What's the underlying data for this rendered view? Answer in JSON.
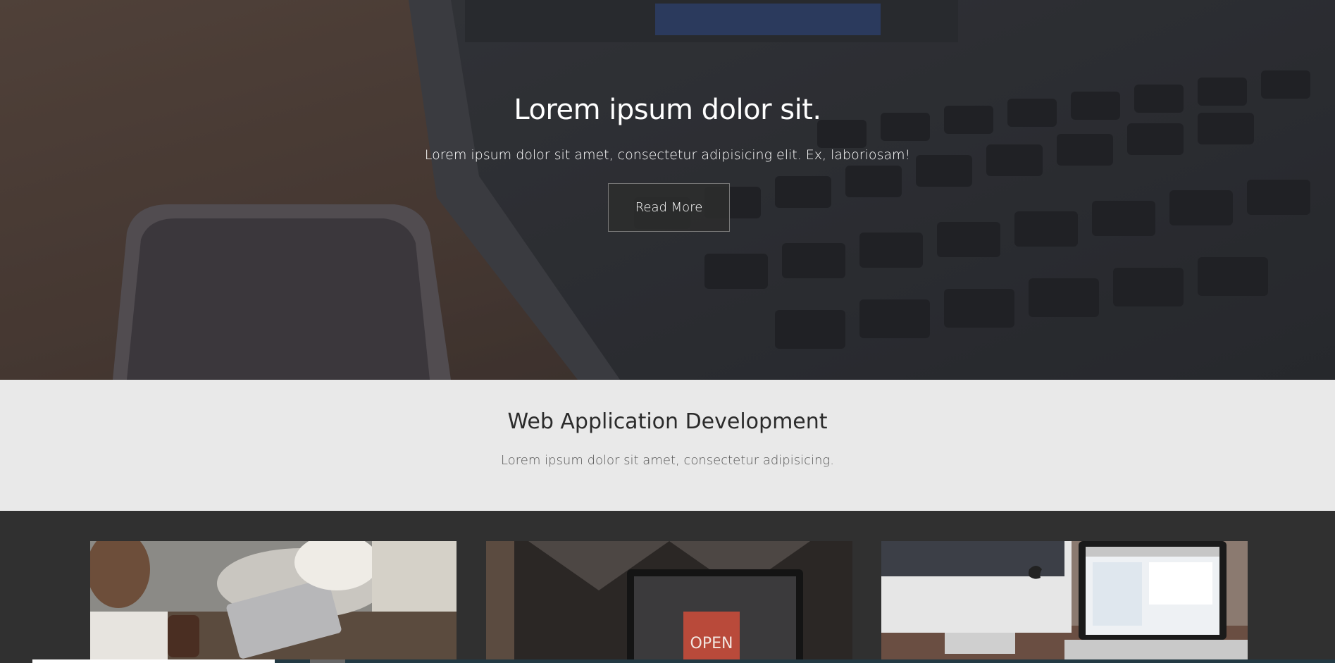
{
  "hero": {
    "title": "Lorem ipsum dolor sit.",
    "subtitle": "Lorem ipsum dolor sit amet, consectetur adipisicing elit. Ex, laboriosam!",
    "button_label": "Read More"
  },
  "section": {
    "title": "Web Application Development",
    "subtitle": "Lorem ipsum dolor sit amet, consectetur adipisicing."
  },
  "cards": [
    {
      "name": "card-image-meeting"
    },
    {
      "name": "card-image-open-sign-laptop"
    },
    {
      "name": "card-image-imac-macbook"
    }
  ],
  "card_sign_text": "OPEN",
  "colors": {
    "hero_overlay": "#2a2c2f",
    "section_bg": "#e9e9e9",
    "cards_bg": "#303030",
    "button_bg": "#2d2d2d"
  }
}
